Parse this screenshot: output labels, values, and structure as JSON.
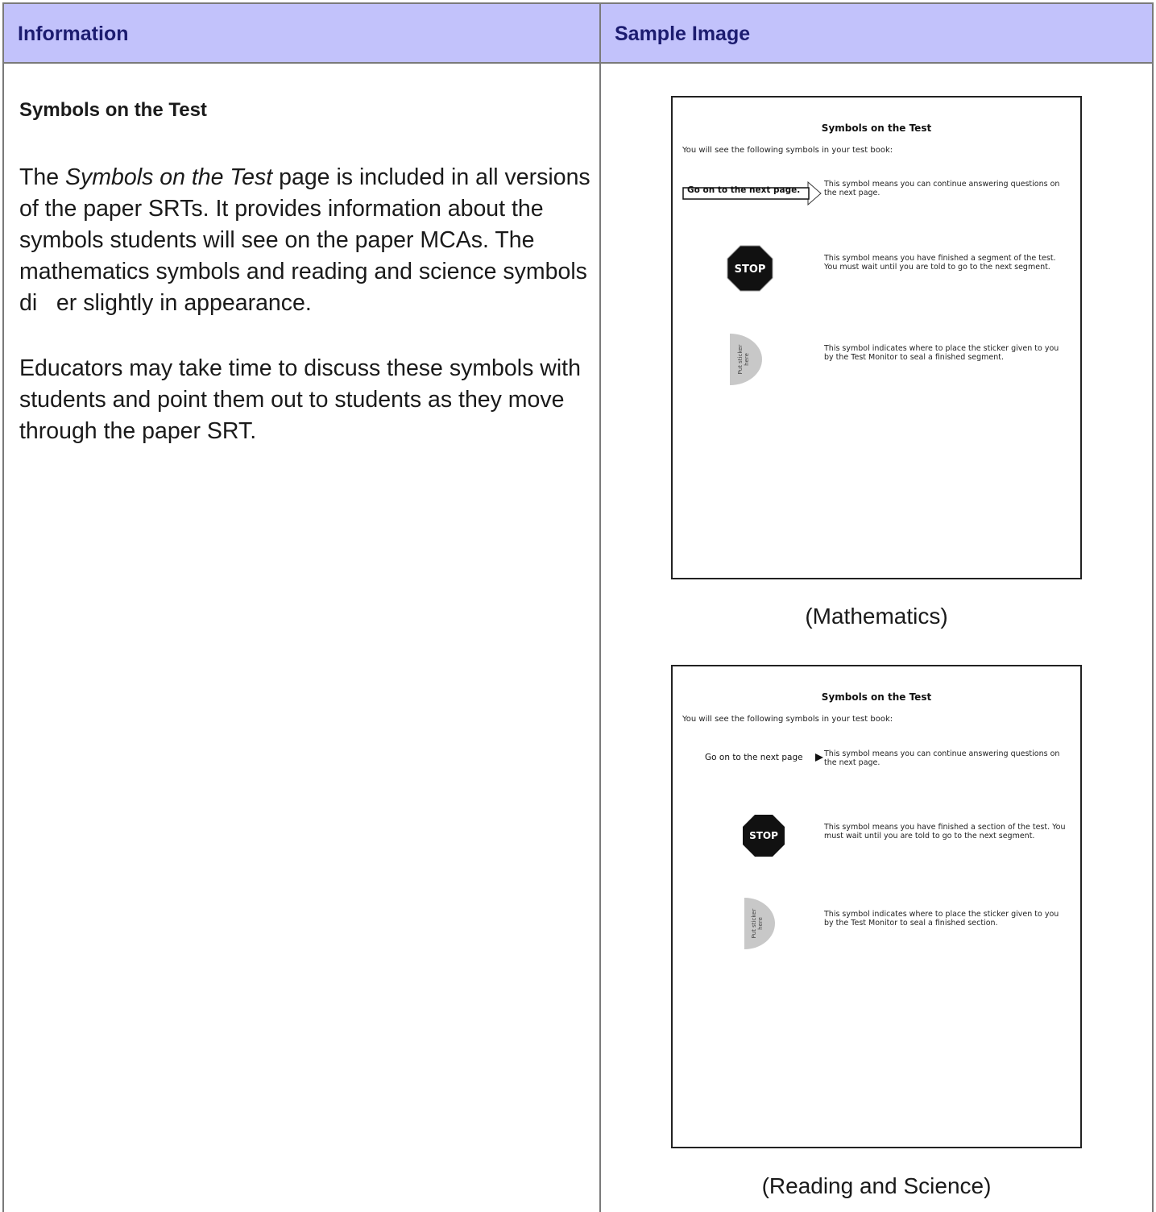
{
  "headers": {
    "left": "Information",
    "right": "Sample Image"
  },
  "info": {
    "title": "Symbols on the Test",
    "para1_prefix": "The ",
    "para1_italic": "Symbols on the Test",
    "para1_rest": " page is included in all versions of the paper SRTs. It provides information about the symbols students will see on the paper MCAs. The mathematics symbols and reading and science symbols di   er slightly in appearance.",
    "para2": "Educators may take time to discuss these symbols with students and point them out to students as they move through the paper SRT."
  },
  "math_sample": {
    "title": "Symbols on the Test",
    "intro": "You will see the following symbols in your test book:",
    "goon_label": "Go on to the next page.",
    "goon_desc": "This symbol means you can continue answering questions on the next page.",
    "stop_label": "STOP",
    "stop_desc": "This symbol means you have finished a segment of the test. You must wait until you are told to go to the next segment.",
    "sticker_label_1": "Put sticker",
    "sticker_label_2": "here",
    "sticker_desc": "This symbol indicates where to place the sticker given to you by the Test Monitor to seal a finished segment.",
    "caption": "(Mathematics)"
  },
  "reading_sample": {
    "title": "Symbols on the Test",
    "intro": "You will see the following symbols in your test book:",
    "goon_label": "Go on to the next page",
    "goon_desc": "This symbol means you can continue answering questions on the next page.",
    "stop_label": "STOP",
    "stop_desc": "This symbol means you have finished a section of the test. You must wait until you are told to go to the next segment.",
    "sticker_label_1": "Put sticker",
    "sticker_label_2": "here",
    "sticker_desc": "This symbol indicates where to place the sticker given to you by the Test Monitor to seal a finished section.",
    "caption": "(Reading and Science)"
  },
  "colors": {
    "header_bg": "#c2c2fb",
    "header_text": "#1c1c70",
    "border": "#7a7a7a",
    "sticker_fill": "#c8c8c8"
  }
}
